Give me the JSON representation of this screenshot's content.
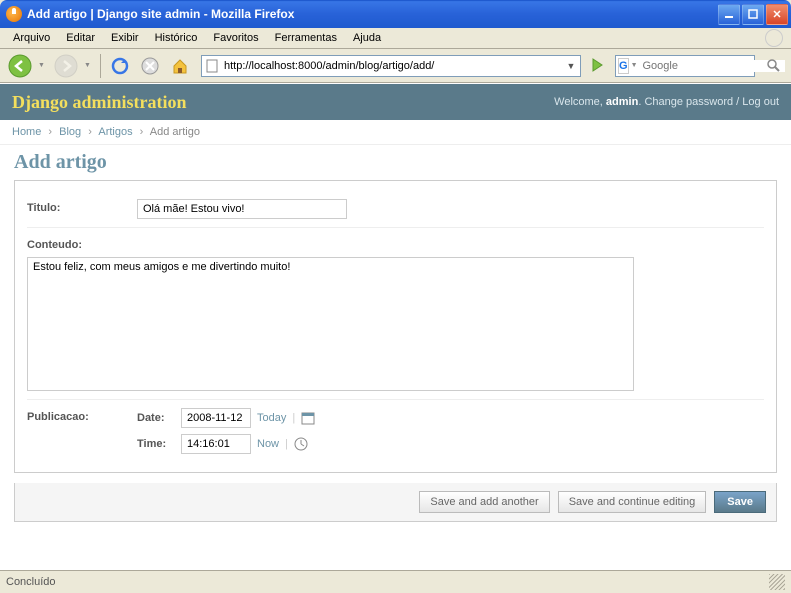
{
  "window": {
    "title": "Add artigo | Django site admin - Mozilla Firefox"
  },
  "menu": {
    "items": [
      "Arquivo",
      "Editar",
      "Exibir",
      "Histórico",
      "Favoritos",
      "Ferramentas",
      "Ajuda"
    ]
  },
  "toolbar": {
    "url": "http://localhost:8000/admin/blog/artigo/add/",
    "search_placeholder": "Google",
    "search_engine": "G"
  },
  "django": {
    "header_title": "Django administration",
    "welcome_prefix": "Welcome, ",
    "username": "admin",
    "change_password": "Change password",
    "logout": "Log out"
  },
  "breadcrumbs": {
    "home": "Home",
    "app": "Blog",
    "model": "Artigos",
    "current": "Add artigo"
  },
  "page": {
    "title": "Add artigo"
  },
  "form": {
    "titulo_label": "Titulo:",
    "titulo_value": "Olá mãe! Estou vivo!",
    "conteudo_label": "Conteudo:",
    "conteudo_value": "Estou feliz, com meus amigos e me divertindo muito!",
    "publicacao_label": "Publicacao:",
    "date_label": "Date:",
    "date_value": "2008-11-12",
    "today_link": "Today",
    "time_label": "Time:",
    "time_value": "14:16:01",
    "now_link": "Now"
  },
  "buttons": {
    "save_add": "Save and add another",
    "save_continue": "Save and continue editing",
    "save": "Save"
  },
  "statusbar": {
    "text": "Concluído"
  }
}
